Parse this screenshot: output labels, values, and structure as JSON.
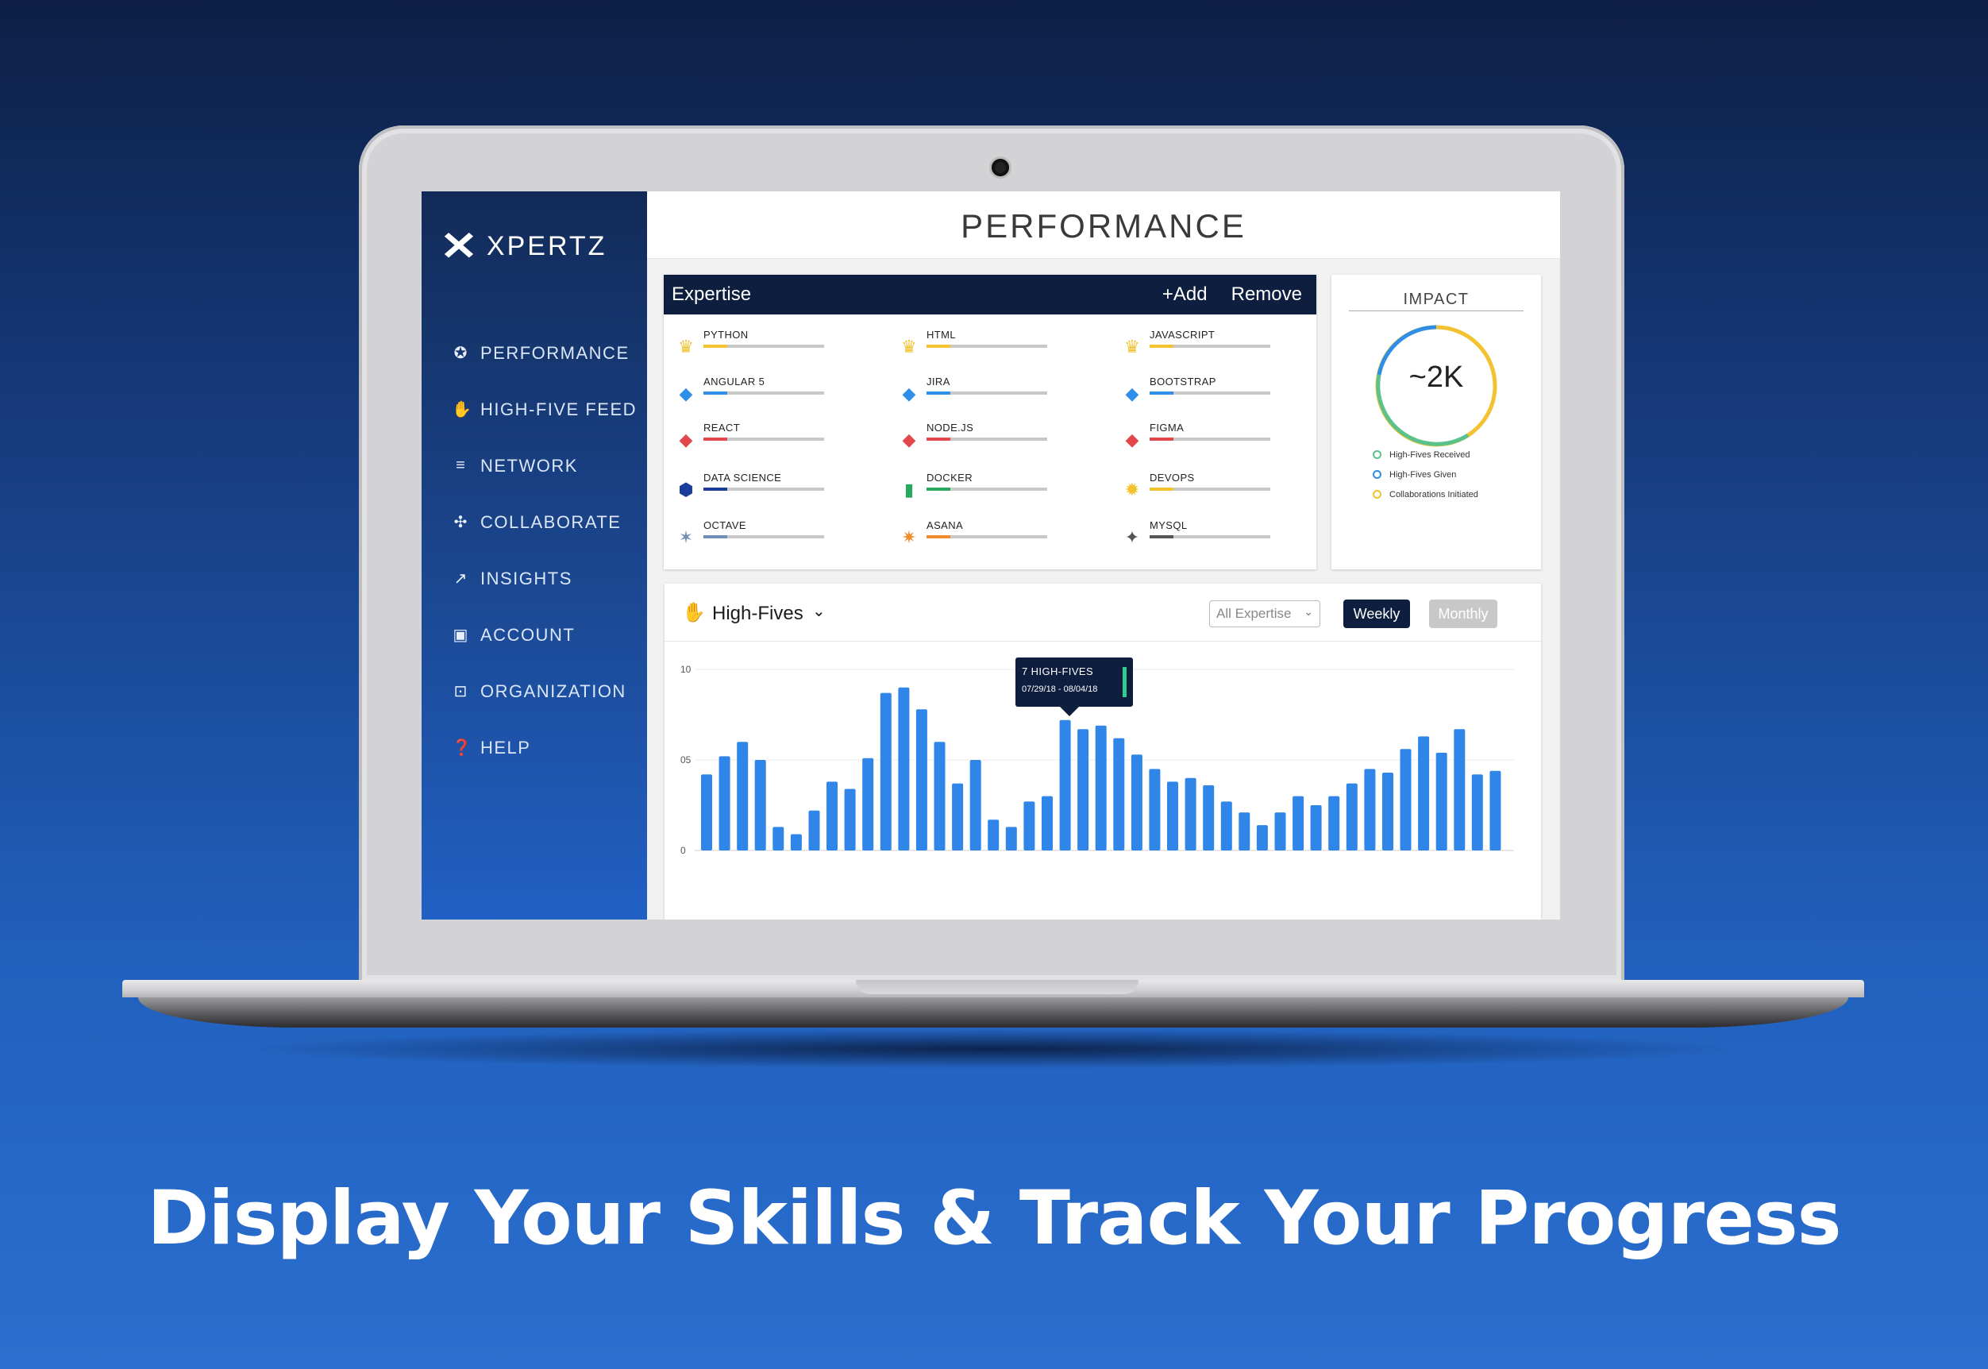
{
  "app": {
    "brand": "XPERTZ",
    "page_title": "PERFORMANCE"
  },
  "sidebar": {
    "items": [
      {
        "label": "PERFORMANCE",
        "icon": "performance-icon"
      },
      {
        "label": "HIGH-FIVE FEED",
        "icon": "hand-icon"
      },
      {
        "label": "NETWORK",
        "icon": "list-icon"
      },
      {
        "label": "COLLABORATE",
        "icon": "puzzle-icon"
      },
      {
        "label": "INSIGHTS",
        "icon": "trend-icon"
      },
      {
        "label": "ACCOUNT",
        "icon": "account-icon"
      },
      {
        "label": "ORGANIZATION",
        "icon": "briefcase-icon"
      },
      {
        "label": "HELP",
        "icon": "help-icon"
      }
    ]
  },
  "expertise": {
    "title": "Expertise",
    "add_label": "+Add",
    "remove_label": "Remove",
    "skills": [
      {
        "name": "PYTHON",
        "icon": "crown-icon",
        "color": "#f2c230",
        "level": 0.2
      },
      {
        "name": "HTML",
        "icon": "crown-icon",
        "color": "#f2c230",
        "level": 0.2
      },
      {
        "name": "JAVASCRIPT",
        "icon": "crown-icon",
        "color": "#f2c230",
        "level": 0.2
      },
      {
        "name": "ANGULAR 5",
        "icon": "diamond-icon",
        "color": "#2f8fe8",
        "level": 0.2
      },
      {
        "name": "JIRA",
        "icon": "diamond-icon",
        "color": "#2f8fe8",
        "level": 0.2
      },
      {
        "name": "BOOTSTRAP",
        "icon": "diamond-icon",
        "color": "#2f8fe8",
        "level": 0.2
      },
      {
        "name": "REACT",
        "icon": "ruby-icon",
        "color": "#e2474b",
        "level": 0.2
      },
      {
        "name": "NODE.JS",
        "icon": "ruby-icon",
        "color": "#e2474b",
        "level": 0.2
      },
      {
        "name": "FIGMA",
        "icon": "ruby-icon",
        "color": "#e2474b",
        "level": 0.2
      },
      {
        "name": "DATA SCIENCE",
        "icon": "hexagon-icon",
        "color": "#1c3c9c",
        "level": 0.2
      },
      {
        "name": "DOCKER",
        "icon": "emerald-icon",
        "color": "#27a85c",
        "level": 0.2
      },
      {
        "name": "DEVOPS",
        "icon": "sun-icon",
        "color": "#f2c230",
        "level": 0.2
      },
      {
        "name": "OCTAVE",
        "icon": "star-icon",
        "color": "#6f8fb8",
        "level": 0.2
      },
      {
        "name": "ASANA",
        "icon": "burst-icon",
        "color": "#f08c2c",
        "level": 0.2
      },
      {
        "name": "MYSQL",
        "icon": "sparkle-icon",
        "color": "#555555",
        "level": 0.2
      }
    ]
  },
  "impact": {
    "title": "IMPACT",
    "value": "~2K",
    "legend": [
      {
        "label": "High-Fives Received",
        "color": "#5cc28c"
      },
      {
        "label": "High-Fives Given",
        "color": "#2f8fe8"
      },
      {
        "label": "Collaborations Initiated",
        "color": "#f2c230"
      }
    ]
  },
  "high_fives": {
    "title": "High-Fives",
    "filter_value": "All Expertise",
    "weekly_label": "Weekly",
    "monthly_label": "Monthly",
    "tooltip_main": "7 HIGH-FIVES",
    "tooltip_sub": "07/29/18 - 08/04/18",
    "bar_color": "#2f86e8",
    "accent": "#0e1e3e"
  },
  "chart_data": {
    "type": "bar",
    "title": "",
    "xlabel": "",
    "ylabel": "",
    "ylim": [
      0,
      10
    ],
    "y_ticks": [
      "10",
      "05",
      "0"
    ],
    "values": [
      4.2,
      5.2,
      6.0,
      5.0,
      1.3,
      0.9,
      2.2,
      3.8,
      3.4,
      5.1,
      8.7,
      9.0,
      7.8,
      6.0,
      3.7,
      5.0,
      1.7,
      1.3,
      2.7,
      3.0,
      7.2,
      6.7,
      6.9,
      6.2,
      5.3,
      4.5,
      3.8,
      4.0,
      3.6,
      2.7,
      2.1,
      1.4,
      2.1,
      3.0,
      2.5,
      3.0,
      3.7,
      4.5,
      4.3,
      5.6,
      6.3,
      5.4,
      6.7,
      4.2,
      4.4
    ],
    "grid": true,
    "legend": "none"
  }
}
